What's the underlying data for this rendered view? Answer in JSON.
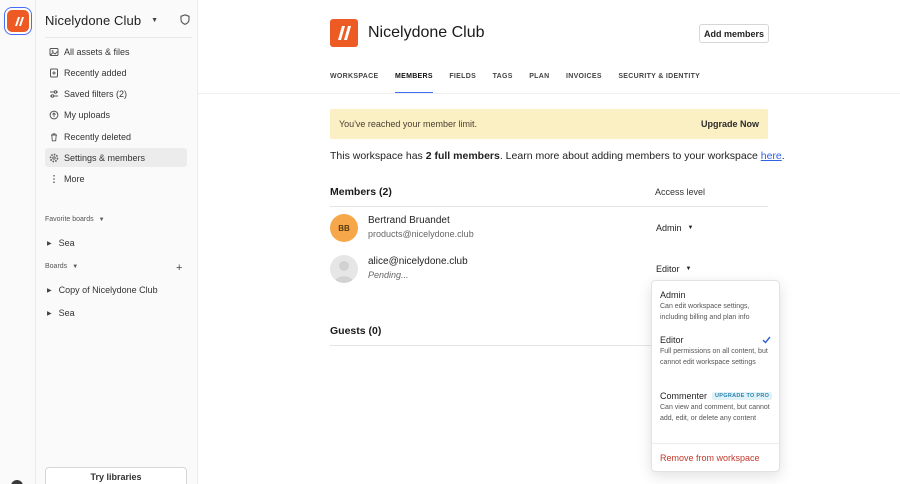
{
  "sidebar": {
    "workspace_name": "Nicelydone Club",
    "nav": [
      {
        "label": "All assets & files",
        "icon": "assets-icon"
      },
      {
        "label": "Recently added",
        "icon": "recently-added-icon"
      },
      {
        "label": "Saved filters (2)",
        "icon": "filters-icon"
      },
      {
        "label": "My uploads",
        "icon": "uploads-icon"
      },
      {
        "label": "Recently deleted",
        "icon": "trash-icon"
      },
      {
        "label": "Settings & members",
        "icon": "gear-icon"
      },
      {
        "label": "More",
        "icon": "more-icon"
      }
    ],
    "favorite_label": "Favorite boards",
    "favorites": [
      "Sea"
    ],
    "boards_label": "Boards",
    "boards": [
      "Copy of Nicelydone Club",
      "Sea"
    ],
    "try_libraries": "Try libraries"
  },
  "header": {
    "title": "Nicelydone Club",
    "add_members": "Add members"
  },
  "tabs": [
    "WORKSPACE",
    "MEMBERS",
    "FIELDS",
    "TAGS",
    "PLAN",
    "INVOICES",
    "SECURITY & IDENTITY"
  ],
  "active_tab": "MEMBERS",
  "banner": {
    "text": "You've reached your member limit.",
    "action": "Upgrade Now"
  },
  "info": {
    "prefix": "This workspace has ",
    "bold": "2 full members",
    "middle": ". Learn more about adding members to your workspace ",
    "link": "here",
    "suffix": "."
  },
  "members_header": "Members (2)",
  "access_header": "Access level",
  "members": [
    {
      "initials": "BB",
      "name": "Bertrand Bruandet",
      "sub": "products@nicelydone.club",
      "role": "Admin"
    },
    {
      "initials": "",
      "name": "alice@nicelydone.club",
      "sub": "Pending...",
      "role": "Editor"
    }
  ],
  "guests_header": "Guests (0)",
  "dropdown": {
    "options": [
      {
        "title": "Admin",
        "desc": "Can edit workspace settings, including billing and plan info"
      },
      {
        "title": "Editor",
        "desc": "Full permissions on all content, but cannot edit workspace settings",
        "selected": true
      },
      {
        "title": "Commenter",
        "badge": "UPGRADE TO PRO",
        "desc": "Can view and comment, but cannot add, edit, or delete any content"
      }
    ],
    "remove": "Remove from workspace"
  },
  "colors": {
    "brand": "#ee5a24",
    "tab_underline": "#3b6ff5",
    "banner_bg": "#fbefc4",
    "danger": "#c0392b",
    "link": "#2e63e6"
  }
}
